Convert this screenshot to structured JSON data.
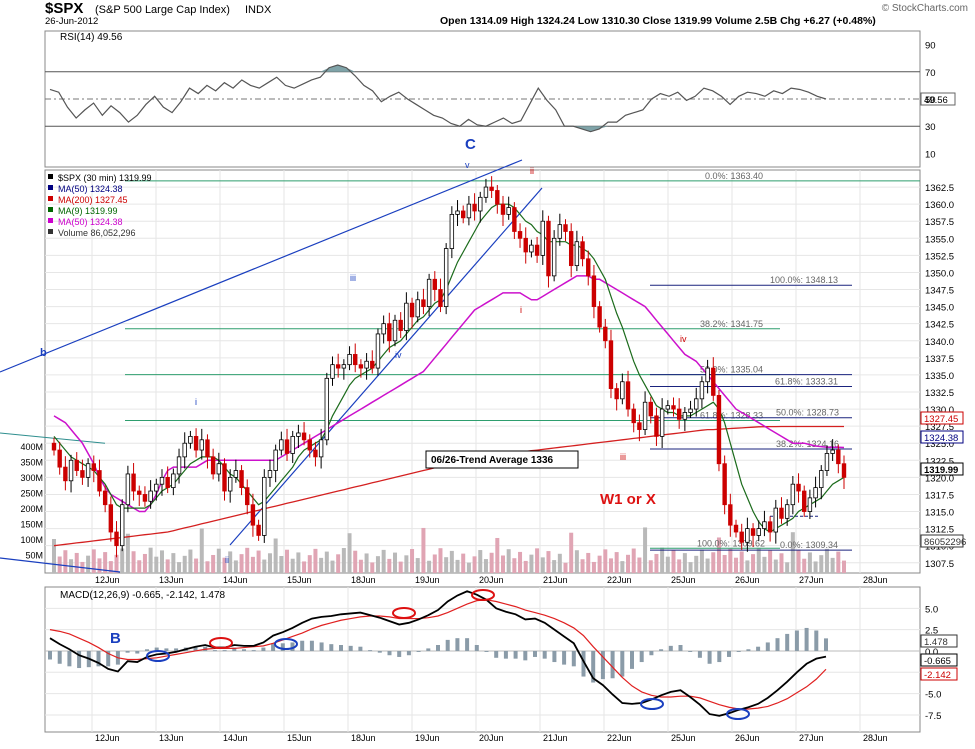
{
  "header": {
    "symbol": "$SPX",
    "name": "(S&P 500 Large Cap Index)",
    "exchange": "INDX",
    "date": "26-Jun-2012",
    "ohlc_text": "Open 1314.09  High 1324.24  Low 1310.30  Close 1319.99  Volume 2.5B  Chg +6.27 (+0.48%)",
    "watermark": "© StockCharts.com"
  },
  "rsi": {
    "label": "RSI(14) 49.56",
    "last_value": "49.56",
    "y_ticks": [
      "90",
      "70",
      "50",
      "30",
      "10"
    ],
    "values": [
      57,
      55,
      44,
      36,
      42,
      47,
      38,
      45,
      40,
      33,
      38,
      46,
      52,
      44,
      40,
      48,
      58,
      54,
      60,
      56,
      62,
      58,
      64,
      60,
      58,
      62,
      66,
      60,
      58,
      61,
      64,
      66,
      73,
      75,
      73,
      67,
      60,
      56,
      48,
      52,
      55,
      50,
      46,
      42,
      38,
      36,
      32,
      30,
      35,
      31,
      30,
      33,
      36,
      32,
      34,
      46,
      58,
      49,
      42,
      30,
      30,
      28,
      26,
      28,
      33,
      33,
      38,
      40,
      42,
      50,
      54,
      52,
      55,
      49,
      52,
      58,
      56,
      52,
      46,
      52,
      55,
      54,
      52,
      56,
      54,
      58,
      57,
      55,
      52,
      50
    ]
  },
  "price": {
    "legend": [
      {
        "text": "$SPX (30 min) 1319.99",
        "color": "#000000"
      },
      {
        "text": "MA(50) 1324.38",
        "color": "#000080"
      },
      {
        "text": "MA(200) 1327.45",
        "color": "#cc0000"
      },
      {
        "text": "MA(9) 1319.99",
        "color": "#006600"
      },
      {
        "text": "MA(50) 1324.38",
        "color": "#cc00cc"
      },
      {
        "text": "Volume 86,052,296",
        "color": "#333333"
      }
    ],
    "y_ticks": [
      "1362.5",
      "1360.0",
      "1357.5",
      "1355.0",
      "1352.5",
      "1350.0",
      "1347.5",
      "1345.0",
      "1342.5",
      "1340.0",
      "1337.5",
      "1335.0",
      "1332.5",
      "1330.0",
      "1327.5",
      "1325.0",
      "1322.5",
      "1320.0",
      "1317.5",
      "1315.0",
      "1312.5",
      "1310.0",
      "1307.5"
    ],
    "volume_ticks": [
      "400M",
      "350M",
      "300M",
      "250M",
      "200M",
      "150M",
      "100M",
      "50M"
    ],
    "right_badges": [
      {
        "text": "1327.45",
        "color": "#cc0000"
      },
      {
        "text": "1324.38",
        "color": "#000080"
      },
      {
        "text": "1319.99",
        "color": "#000000"
      },
      {
        "text": "86052296",
        "color": "#333333"
      }
    ],
    "x_labels": [
      "12Jun",
      "13Jun",
      "14Jun",
      "15Jun",
      "18Jun",
      "19Jun",
      "20Jun",
      "21Jun",
      "22Jun",
      "25Jun",
      "26Jun",
      "27Jun",
      "28Jun"
    ],
    "trend_box": "06/26-Trend Average 1336",
    "wave_labels": {
      "C": "C",
      "b": "b",
      "B": "B",
      "i": "i",
      "ii": "ii",
      "iii": "iii",
      "iv": "iv",
      "v": "v",
      "w1": "W1 or X",
      "iii_blue": "iii",
      "iv_blue": "iv",
      "i_blue": "i",
      "ii_low": "ii"
    },
    "fib_left": [
      {
        "text": "0.0%: 1363.40"
      },
      {
        "text": "38.2%: 1341.75"
      },
      {
        "text": "61.8%: 1328.33"
      },
      {
        "text": "100.0%: 1309.62"
      }
    ],
    "fib_right": [
      {
        "text": "100.0%: 1348.13"
      },
      {
        "text": "50.0%: 1335.04"
      },
      {
        "text": "61.8%: 1333.31"
      },
      {
        "text": "50.0%: 1328.73"
      },
      {
        "text": "38.2%: 1324.16"
      },
      {
        "text": "0.0%: 1309.34"
      }
    ]
  },
  "macd": {
    "label": "MACD(12,26,9) -0.665, -2.142, 1.478",
    "y_ticks": [
      "5.0",
      "2.5",
      "0.0",
      "-2.5",
      "-5.0",
      "-7.5"
    ],
    "right_badges": [
      {
        "text": "1.478",
        "color": "#333333"
      },
      {
        "text": "-0.665",
        "color": "#000000"
      },
      {
        "text": "-2.142",
        "color": "#cc0000"
      }
    ],
    "x_labels": [
      "12Jun",
      "13Jun",
      "14Jun",
      "15Jun",
      "18Jun",
      "19Jun",
      "20Jun",
      "21Jun",
      "22Jun",
      "25Jun",
      "26Jun",
      "27Jun",
      "28Jun"
    ]
  },
  "chart_data": {
    "type": "candlestick",
    "title": "$SPX (S&P 500 Large Cap Index) INDX",
    "interval": "30 min",
    "ylim": [
      1306,
      1365
    ],
    "close": [
      1324.0,
      1321.5,
      1319.5,
      1322.5,
      1321.0,
      1320.0,
      1322.0,
      1321.0,
      1318.0,
      1316.0,
      1312.0,
      1310.0,
      1316.0,
      1320.5,
      1318.0,
      1317.5,
      1316.5,
      1318.0,
      1319.0,
      1320.0,
      1318.5,
      1320.5,
      1323.0,
      1325.0,
      1326.0,
      1324.0,
      1325.5,
      1323.0,
      1320.5,
      1322.0,
      1318.0,
      1320.0,
      1321.0,
      1318.5,
      1316.0,
      1313.0,
      1311.5,
      1320.0,
      1321.0,
      1324.0,
      1325.5,
      1323.5,
      1326.0,
      1326.5,
      1325.5,
      1324.0,
      1323.0,
      1325.5,
      1334.5,
      1336.5,
      1336.0,
      1336.5,
      1338.0,
      1336.5,
      1336.0,
      1337.0,
      1336.0,
      1341.0,
      1342.5,
      1340.0,
      1343.0,
      1341.5,
      1345.5,
      1343.5,
      1346.0,
      1345.0,
      1349.0,
      1347.5,
      1345.0,
      1353.5,
      1358.5,
      1359.0,
      1358.0,
      1360.0,
      1359.0,
      1361.0,
      1362.5,
      1362.0,
      1360.0,
      1358.5,
      1359.5,
      1356.0,
      1355.0,
      1353.0,
      1354.0,
      1352.5,
      1357.5,
      1349.5,
      1355.0,
      1357.0,
      1356.0,
      1351.0,
      1354.5,
      1352.0,
      1349.5,
      1345.0,
      1342.0,
      1340.0,
      1333.0,
      1331.5,
      1334.0,
      1330.0,
      1328.0,
      1327.0,
      1331.0,
      1329.0,
      1326.0,
      1330.0,
      1330.5,
      1330.0,
      1328.5,
      1329.5,
      1330.0,
      1331.5,
      1334.0,
      1336.0,
      1332.0,
      1322.0,
      1316.0,
      1313.0,
      1312.0,
      1310.5,
      1312.5,
      1311.5,
      1312.5,
      1313.5,
      1312.0,
      1315.5,
      1314.0,
      1316.0,
      1319.0,
      1318.0,
      1315.0,
      1317.0,
      1318.5,
      1321.0,
      1323.5,
      1324.0,
      1322.0,
      1320.0
    ],
    "ma50": [
      1329.0,
      1328.5,
      1328.0,
      1327.0,
      1326.0,
      1325.0,
      1323.5,
      1322.0,
      1320.0,
      1318.5,
      1317.5,
      1317.0,
      1316.5,
      1316.0,
      1315.5,
      1315.0,
      1315.0,
      1316.0,
      1317.5,
      1319.5,
      1321.0,
      1321.5,
      1321.5,
      1321.5,
      1321.5,
      1321.5,
      1322.0,
      1322.5,
      1322.5,
      1322.5,
      1322.5,
      1322.5,
      1322.5,
      1322.5,
      1322.5,
      1322.5,
      1322.5,
      1322.5,
      1322.5,
      1322.5,
      1323.0,
      1323.5,
      1324.0,
      1324.5,
      1325.0,
      1325.5,
      1326.0,
      1326.5,
      1327.0,
      1327.5,
      1328.0,
      1328.5,
      1329.0,
      1329.5,
      1330.0,
      1330.5,
      1331.0,
      1331.5,
      1332.0,
      1332.5,
      1333.0,
      1333.5,
      1334.0,
      1334.5,
      1335.0,
      1335.5,
      1336.5,
      1337.5,
      1338.5,
      1339.5,
      1340.5,
      1341.5,
      1342.5,
      1343.5,
      1344.5,
      1345.0,
      1345.5,
      1346.0,
      1346.5,
      1347.0,
      1347.0,
      1347.0,
      1347.0,
      1346.5,
      1346.0,
      1346.0,
      1346.5,
      1347.0,
      1347.5,
      1348.0,
      1348.5,
      1349.0,
      1349.5,
      1349.5,
      1349.5,
      1349.0,
      1349.0,
      1348.5,
      1348.0,
      1347.5,
      1347.0,
      1346.5,
      1346.0,
      1345.5,
      1345.0,
      1344.0,
      1343.0,
      1342.0,
      1341.0,
      1340.0,
      1339.0,
      1338.0,
      1337.5,
      1337.0,
      1336.0,
      1335.0,
      1334.0,
      1333.0,
      1332.0,
      1331.0,
      1330.0,
      1329.5,
      1329.0,
      1328.5,
      1328.0,
      1327.5,
      1327.0,
      1326.5,
      1326.0,
      1325.5,
      1325.0,
      1325.0,
      1325.0,
      1324.8,
      1324.6,
      1324.5,
      1324.4,
      1324.4,
      1324.4,
      1324.38
    ],
    "ma200": [
      1310.0,
      1310.1,
      1310.2,
      1310.3,
      1310.4,
      1310.5,
      1310.6,
      1310.7,
      1310.8,
      1310.9,
      1311.0,
      1311.1,
      1311.2,
      1311.3,
      1311.4,
      1311.5,
      1311.6,
      1311.7,
      1311.8,
      1311.9,
      1312.0,
      1312.2,
      1312.4,
      1312.6,
      1312.8,
      1313.0,
      1313.2,
      1313.4,
      1313.6,
      1313.8,
      1314.0,
      1314.2,
      1314.4,
      1314.6,
      1314.8,
      1315.0,
      1315.2,
      1315.4,
      1315.6,
      1315.8,
      1316.0,
      1316.2,
      1316.4,
      1316.6,
      1316.8,
      1317.0,
      1317.2,
      1317.4,
      1317.6,
      1317.8,
      1318.0,
      1318.2,
      1318.4,
      1318.6,
      1318.8,
      1319.0,
      1319.2,
      1319.4,
      1319.6,
      1319.8,
      1320.0,
      1320.2,
      1320.4,
      1320.6,
      1320.8,
      1321.0,
      1321.2,
      1321.4,
      1321.6,
      1321.8,
      1322.0,
      1322.2,
      1322.4,
      1322.6,
      1322.8,
      1323.0,
      1323.1,
      1323.2,
      1323.3,
      1323.4,
      1323.5,
      1323.6,
      1323.7,
      1323.8,
      1323.9,
      1324.0,
      1324.1,
      1324.2,
      1324.3,
      1324.4,
      1324.5,
      1324.6,
      1324.7,
      1324.8,
      1324.9,
      1325.0,
      1325.1,
      1325.2,
      1325.3,
      1325.4,
      1325.5,
      1325.6,
      1325.7,
      1325.8,
      1325.9,
      1326.0,
      1326.1,
      1326.2,
      1326.3,
      1326.4,
      1326.5,
      1326.6,
      1326.7,
      1326.8,
      1326.9,
      1327.0,
      1327.0,
      1327.05,
      1327.1,
      1327.15,
      1327.2,
      1327.25,
      1327.3,
      1327.35,
      1327.4,
      1327.42,
      1327.43,
      1327.44,
      1327.45,
      1327.45,
      1327.45,
      1327.45,
      1327.45,
      1327.45,
      1327.45,
      1327.45,
      1327.45,
      1327.45,
      1327.45,
      1327.45
    ],
    "ma9": [
      1326.0,
      1325.0,
      1324.0,
      1323.0,
      1322.5,
      1322.0,
      1321.5,
      1321.0,
      1320.0,
      1319.0,
      1317.5,
      1316.0,
      1315.5,
      1315.5,
      1315.5,
      1315.5,
      1315.5,
      1316.0,
      1317.0,
      1318.0,
      1318.5,
      1319.0,
      1320.0,
      1321.0,
      1322.0,
      1322.5,
      1323.0,
      1323.0,
      1323.0,
      1322.5,
      1321.5,
      1320.5,
      1320.0,
      1319.0,
      1318.0,
      1317.0,
      1316.0,
      1316.5,
      1317.5,
      1318.5,
      1319.5,
      1320.5,
      1321.5,
      1323.0,
      1324.0,
      1324.5,
      1325.0,
      1325.5,
      1327.0,
      1329.0,
      1330.5,
      1332.0,
      1333.5,
      1334.5,
      1335.0,
      1335.5,
      1336.0,
      1337.0,
      1338.0,
      1339.0,
      1339.5,
      1340.0,
      1341.0,
      1342.0,
      1343.0,
      1343.5,
      1344.5,
      1345.5,
      1346.0,
      1347.5,
      1349.5,
      1351.5,
      1353.0,
      1354.5,
      1356.0,
      1357.5,
      1358.5,
      1359.5,
      1360.0,
      1360.0,
      1360.0,
      1359.5,
      1358.5,
      1357.5,
      1357.0,
      1356.0,
      1355.5,
      1354.5,
      1354.5,
      1354.5,
      1354.5,
      1354.0,
      1354.0,
      1353.5,
      1353.0,
      1352.0,
      1350.5,
      1349.0,
      1346.5,
      1344.0,
      1342.0,
      1339.5,
      1337.0,
      1335.0,
      1333.5,
      1332.0,
      1330.5,
      1330.0,
      1329.5,
      1329.5,
      1329.0,
      1329.0,
      1329.0,
      1329.5,
      1330.0,
      1330.5,
      1331.0,
      1330.0,
      1328.0,
      1325.0,
      1322.0,
      1319.0,
      1317.0,
      1315.0,
      1313.5,
      1312.5,
      1312.0,
      1312.5,
      1313.0,
      1313.5,
      1314.0,
      1315.0,
      1315.5,
      1316.0,
      1316.5,
      1317.0,
      1318.0,
      1319.0,
      1319.5,
      1319.99
    ],
    "macd_line": [
      1.5,
      0.8,
      0.2,
      -0.5,
      -0.9,
      -1.4,
      -2.1,
      -2.4,
      -1.2,
      -1.3,
      -0.7,
      -0.4,
      -0.3,
      -0.1,
      0.2,
      0.5,
      0.7,
      0.4,
      0.4,
      0.7,
      0.6,
      0.6,
      1.0,
      1.8,
      2.2,
      2.7,
      3.3,
      3.8,
      4.0,
      4.1,
      4.3,
      4.4,
      4.5,
      4.2,
      3.9,
      3.5,
      3.1,
      3.3,
      3.7,
      4.2,
      4.8,
      5.8,
      6.5,
      7.0,
      6.6,
      6.0,
      5.0,
      4.6,
      4.3,
      3.7,
      3.8,
      3.3,
      2.5,
      1.7,
      0.9,
      -1.2,
      -3.2,
      -4.0,
      -5.1,
      -6.1,
      -6.2,
      -6.1,
      -5.7,
      -5.2,
      -4.8,
      -4.6,
      -5.4,
      -6.3,
      -7.4,
      -7.6,
      -7.3,
      -6.9,
      -6.6,
      -6.2,
      -5.5,
      -4.6,
      -3.6,
      -2.5,
      -1.5,
      -0.9,
      -0.665
    ],
    "macd_signal": [
      2.5,
      2.3,
      2.0,
      1.5,
      1.0,
      0.4,
      -0.3,
      -0.8,
      -1.0,
      -1.0,
      -0.9,
      -0.8,
      -0.6,
      -0.4,
      -0.2,
      0.0,
      0.2,
      0.3,
      0.3,
      0.3,
      0.4,
      0.5,
      0.6,
      0.9,
      1.3,
      1.7,
      2.1,
      2.6,
      3.0,
      3.3,
      3.6,
      3.8,
      4.0,
      4.1,
      4.1,
      4.0,
      3.8,
      3.8,
      3.8,
      3.9,
      4.1,
      4.5,
      5.0,
      5.5,
      5.9,
      6.0,
      5.8,
      5.5,
      5.2,
      4.8,
      4.5,
      4.2,
      3.8,
      3.3,
      2.7,
      1.8,
      0.5,
      -0.7,
      -1.9,
      -3.1,
      -4.1,
      -4.8,
      -5.2,
      -5.4,
      -5.4,
      -5.3,
      -5.3,
      -5.5,
      -5.9,
      -6.3,
      -6.6,
      -6.8,
      -6.8,
      -6.7,
      -6.5,
      -6.1,
      -5.6,
      -4.9,
      -4.2,
      -3.3,
      -2.142
    ],
    "macd_histogram_last": 1.478
  }
}
